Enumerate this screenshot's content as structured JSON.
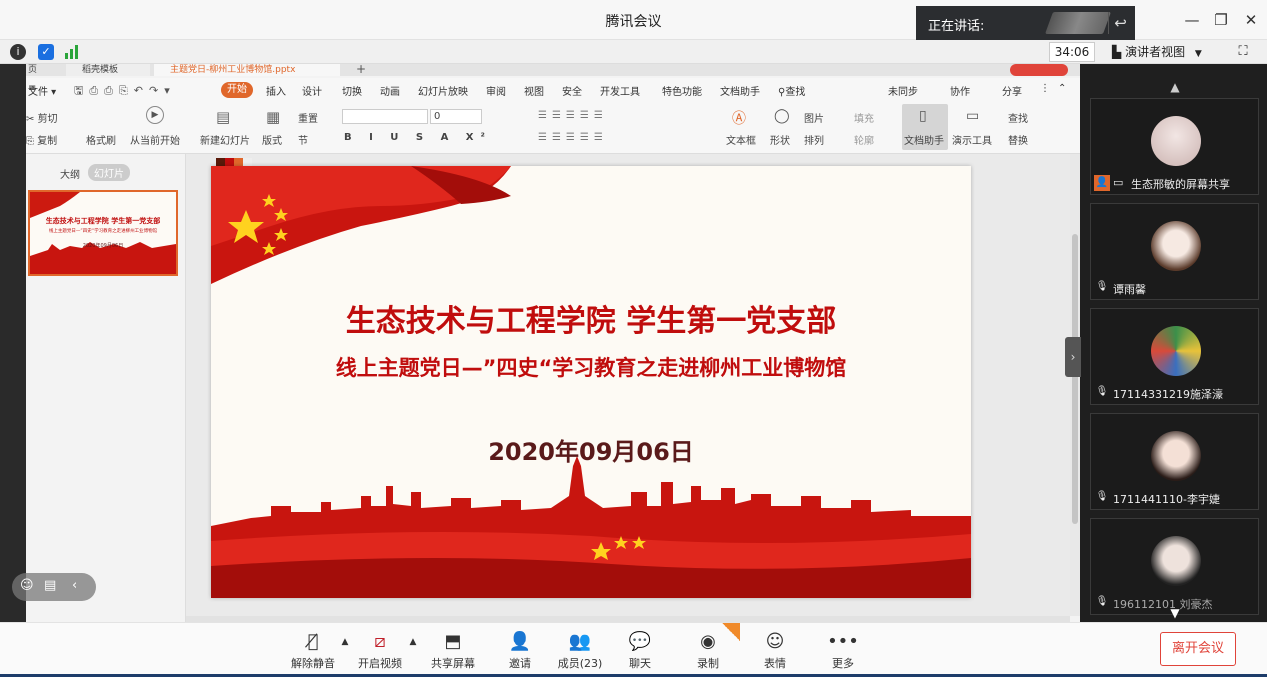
{
  "window": {
    "title": "腾讯会议",
    "speaking_label": "正在讲话:"
  },
  "status": {
    "timer": "34:06",
    "presenter_view": "演讲者视图"
  },
  "wps": {
    "tabs": [
      "页",
      "稻壳模板",
      "主题党日-柳州工业博物馆.pptx"
    ],
    "menus": [
      "文件",
      "开始",
      "插入",
      "设计",
      "切换",
      "动画",
      "幻灯片放映",
      "审阅",
      "视图",
      "安全",
      "开发工具",
      "特色功能",
      "文档助手",
      "查找"
    ],
    "right_menus": [
      "未同步",
      "协作",
      "分享"
    ],
    "ribbon": {
      "cut": "剪切",
      "copy": "复制",
      "format_painter": "格式刷",
      "from_current": "从当前开始",
      "new_slide": "新建幻灯片",
      "layout": "版式",
      "reset": "重置",
      "section": "节",
      "font_size": "0",
      "textbox": "文本框",
      "shape": "形状",
      "picture": "图片",
      "arrange": "排列",
      "fill": "填充",
      "outline": "轮廓",
      "doc_assistant": "文档助手",
      "presentation_tools": "演示工具",
      "find": "查找",
      "replace": "替换"
    },
    "pane_tabs": [
      "大纲",
      "幻灯片"
    ],
    "thumb": {
      "title": "生态技术与工程学院 学生第一党支部",
      "subtitle": "线上主题党日—”四史“学习教育之走进柳州工业博物馆",
      "date": "2020年09月06日"
    }
  },
  "slide": {
    "title": "生态技术与工程学院 学生第一党支部",
    "subtitle": "线上主题党日—”四史“学习教育之走进柳州工业博物馆",
    "date": "2020年09月06日"
  },
  "participants": [
    {
      "name": "生态邢敏的屏幕共享"
    },
    {
      "name": "谭雨馨"
    },
    {
      "name": "17114331219施泽濠"
    },
    {
      "name": "1711441110-李宇婕"
    },
    {
      "name": "196112101 刘豪杰"
    }
  ],
  "toolbar": {
    "unmute": "解除静音",
    "start_video": "开启视频",
    "share_screen": "共享屏幕",
    "invite": "邀请",
    "members": "成员(23)",
    "chat": "聊天",
    "record": "录制",
    "emoji": "表情",
    "more": "更多",
    "leave": "离开会议"
  },
  "colors": {
    "accent_red": "#c00d0d",
    "wps_orange": "#e0672b",
    "leave_red": "#e0443a"
  }
}
